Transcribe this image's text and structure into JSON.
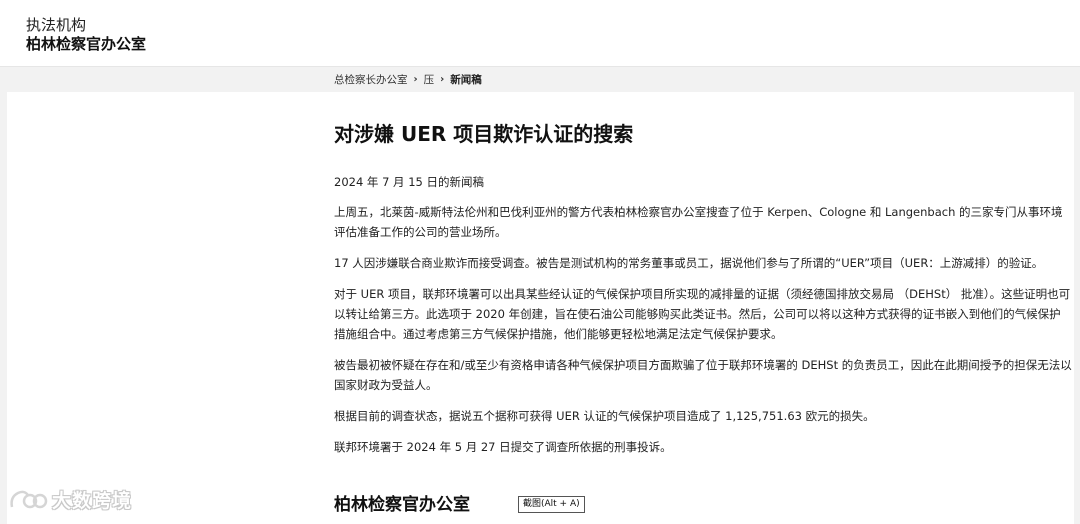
{
  "header": {
    "org_line1": "执法机构",
    "org_line2": "柏林检察官办公室"
  },
  "breadcrumb": {
    "items": [
      "总检察长办公室",
      "压"
    ],
    "current": "新闻稿"
  },
  "article": {
    "title": "对涉嫌 UER 项目欺诈认证的搜索",
    "date": "2024 年 7 月 15 日的新闻稿",
    "paragraphs": [
      "上周五，北莱茵-威斯特法伦州和巴伐利亚州的警方代表柏林检察官办公室搜查了位于 Kerpen、Cologne 和 Langenbach 的三家专门从事环境评估准备工作的公司的营业场所。",
      "17 人因涉嫌联合商业欺诈而接受调查。被告是测试机构的常务董事或员工，据说他们参与了所谓的“UER”项目（UER：上游减排）的验证。",
      "对于 UER 项目，联邦环境署可以出具某些经认证的气候保护项目所实现的减排量的证据（须经德国排放交易局 （DEHSt） 批准）。这些证明也可以转让给第三方。此选项于 2020 年创建，旨在使石油公司能够购买此类证书。然后，公司可以将以这种方式获得的证书嵌入到他们的气候保护措施组合中。通过考虑第三方气候保护措施，他们能够更轻松地满足法定气候保护要求。",
      "被告最初被怀疑在存在和/或至少有资格申请各种气候保护项目方面欺骗了位于联邦环境署的 DEHSt 的负责员工，因此在此期间授予的担保无法以国家财政为受益人。",
      "根据目前的调查状态，据说五个据称可获得 UER 认证的气候保护项目造成了 1,125,751.63 欧元的损失。",
      "联邦环境署于 2024 年 5 月 27 日提交了调查所依据的刑事投诉。"
    ]
  },
  "footer": {
    "title": "柏林检察官办公室"
  },
  "screenshot_tip": "截图(Alt + A)",
  "watermark": {
    "text": "大数跨境",
    "icon": "watermark-logo-icon"
  }
}
